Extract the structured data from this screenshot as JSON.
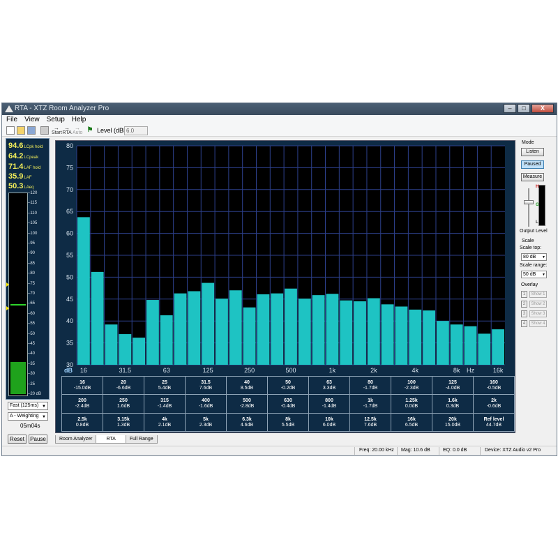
{
  "window": {
    "title": "RTA - XTZ Room Analyzer Pro",
    "buttons": [
      "–",
      "□",
      "X"
    ]
  },
  "menu": [
    "File",
    "View",
    "Setup",
    "Help"
  ],
  "toolbar": {
    "start": "Start",
    "rta": "RTA",
    "auto": "Auto",
    "level_label": "Level (dBFS)",
    "level_value": "6.0"
  },
  "meters": {
    "readouts": [
      {
        "value": "94.6",
        "unit": "LCpk hold"
      },
      {
        "value": "64.2",
        "unit": "LCpeak"
      },
      {
        "value": "71.4",
        "unit": "LAF hold"
      },
      {
        "value": "35.9",
        "unit": "LAF"
      },
      {
        "value": "50.3",
        "unit": "LAeq"
      }
    ],
    "scale_labels": [
      "120",
      "115",
      "110",
      "105",
      "100",
      "95",
      "90",
      "85",
      "80",
      "75",
      "70",
      "65",
      "60",
      "55",
      "50",
      "45",
      "40",
      "35",
      "30",
      "25",
      "20 dB"
    ],
    "level_db": 35.9,
    "hold_db": 64.2,
    "marker1_db": 75,
    "marker2_db": 63,
    "fill_color": "#1fa21c",
    "hold_color": "#2fd42b",
    "speed": "Fast (125ms)",
    "weighting": "A - Weighting",
    "time": "05m04s",
    "reset": "Reset",
    "pause": "Pause"
  },
  "right_panel": {
    "mode_label": "Mode",
    "mode_buttons": [
      "Listen",
      "Paused",
      "Measure"
    ],
    "output_level_label": "Output Level",
    "scale_label": "Scale",
    "scale_top_label": "Scale top:",
    "scale_top_value": "80 dB",
    "scale_range_label": "Scale range:",
    "scale_range_value": "50 dB",
    "overlay_label": "Overlay",
    "overlays": [
      {
        "num": "1",
        "label": "Show 1"
      },
      {
        "num": "2",
        "label": "Show 2"
      },
      {
        "num": "3",
        "label": "Show 3"
      },
      {
        "num": "4",
        "label": "Show 4"
      }
    ],
    "meter_marks": [
      "H",
      "G",
      "L"
    ]
  },
  "chart_data": {
    "type": "bar",
    "ylabel": "dB",
    "xlabel": "Hz",
    "ylim": [
      30,
      80
    ],
    "y_ticks": [
      "80",
      "75",
      "70",
      "65",
      "60",
      "55",
      "50",
      "45",
      "40",
      "35",
      "30"
    ],
    "x_ticks": [
      "16",
      "31.5",
      "63",
      "125",
      "250",
      "500",
      "1k",
      "2k",
      "4k",
      "8k",
      "16k"
    ],
    "grid": true,
    "bar_color": "#1ec3c3",
    "categories": [
      "16",
      "20",
      "25",
      "31.5",
      "40",
      "50",
      "63",
      "80",
      "100",
      "125",
      "160",
      "200",
      "250",
      "315",
      "400",
      "500",
      "630",
      "800",
      "1k",
      "1.25k",
      "1.6k",
      "2k",
      "2.5k",
      "3.15k",
      "4k",
      "5k",
      "6.3k",
      "8k",
      "10k",
      "12.5k",
      "16k"
    ],
    "values": [
      63.7,
      51.2,
      39.2,
      37.0,
      36.2,
      44.8,
      41.3,
      46.3,
      46.8,
      48.7,
      45.1,
      47.0,
      43.1,
      46.1,
      46.3,
      47.4,
      45.1,
      45.9,
      46.2,
      44.7,
      44.5,
      45.2,
      43.8,
      43.3,
      42.6,
      42.4,
      40.0,
      39.2,
      38.8,
      37.1,
      38.1
    ]
  },
  "table": {
    "rows": [
      [
        {
          "f": "16",
          "v": "-15.0dB"
        },
        {
          "f": "20",
          "v": "-6.6dB"
        },
        {
          "f": "25",
          "v": "5.4dB"
        },
        {
          "f": "31.5",
          "v": "7.6dB"
        },
        {
          "f": "40",
          "v": "8.5dB"
        },
        {
          "f": "50",
          "v": "-0.2dB"
        },
        {
          "f": "63",
          "v": "3.3dB"
        },
        {
          "f": "80",
          "v": "-1.7dB"
        },
        {
          "f": "100",
          "v": "-2.3dB"
        },
        {
          "f": "125",
          "v": "-4.0dB"
        },
        {
          "f": "160",
          "v": "-0.5dB"
        }
      ],
      [
        {
          "f": "200",
          "v": "-2.4dB"
        },
        {
          "f": "250",
          "v": "1.6dB"
        },
        {
          "f": "315",
          "v": "-1.4dB"
        },
        {
          "f": "400",
          "v": "-1.6dB"
        },
        {
          "f": "500",
          "v": "-2.8dB"
        },
        {
          "f": "630",
          "v": "-0.4dB"
        },
        {
          "f": "800",
          "v": "-1.4dB"
        },
        {
          "f": "1k",
          "v": "-1.7dB"
        },
        {
          "f": "1.25k",
          "v": "0.0dB"
        },
        {
          "f": "1.6k",
          "v": "0.3dB"
        },
        {
          "f": "2k",
          "v": "-0.6dB"
        }
      ],
      [
        {
          "f": "2.5k",
          "v": "0.8dB"
        },
        {
          "f": "3.15k",
          "v": "1.3dB"
        },
        {
          "f": "4k",
          "v": "2.1dB"
        },
        {
          "f": "5k",
          "v": "2.3dB"
        },
        {
          "f": "6.3k",
          "v": "4.6dB"
        },
        {
          "f": "8k",
          "v": "5.5dB"
        },
        {
          "f": "10k",
          "v": "6.0dB"
        },
        {
          "f": "12.5k",
          "v": "7.6dB"
        },
        {
          "f": "16k",
          "v": "6.5dB"
        },
        {
          "f": "20k",
          "v": "15.0dB"
        },
        {
          "f": "Ref level",
          "v": "44.7dB"
        }
      ]
    ]
  },
  "tabs": [
    "Room Analyzer",
    "RTA",
    "Full Range"
  ],
  "active_tab": 1,
  "status": {
    "freq": "Freq: 20.00 kHz",
    "mag": "Mag: 10.6 dB",
    "eq": "EQ: 0.0 dB",
    "device": "Device: XTZ Audio v2 Pro"
  }
}
